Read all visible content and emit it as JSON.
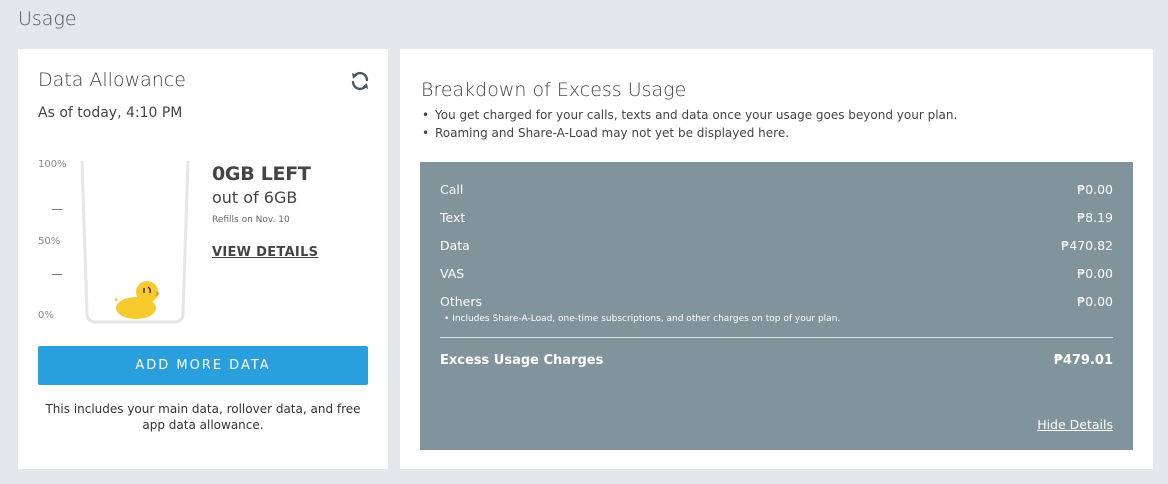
{
  "page": {
    "title": "Usage"
  },
  "data_allowance": {
    "title": "Data Allowance",
    "as_of": "As of today, 4:10 PM",
    "gauge": {
      "labels": [
        "100%",
        "50%",
        "0%"
      ],
      "level_percent": 0
    },
    "left_amount": "0GB LEFT",
    "out_of": "out of 6GB",
    "refills": "Refills on Nov. 10",
    "view_details": "VIEW DETAILS",
    "add_button": "ADD MORE DATA",
    "note": "This includes your main data, rollover data, and free app data allowance.",
    "icon": "refresh-icon"
  },
  "breakdown": {
    "title": "Breakdown of Excess Usage",
    "bullets": [
      "You get charged for your calls, texts and data once your usage goes beyond your plan.",
      "Roaming and Share-A-Load may not yet be displayed here."
    ],
    "rows": [
      {
        "label": "Call",
        "value": "₱0.00"
      },
      {
        "label": "Text",
        "value": "₱8.19"
      },
      {
        "label": "Data",
        "value": "₱470.82"
      },
      {
        "label": "VAS",
        "value": "₱0.00"
      },
      {
        "label": "Others",
        "value": "₱0.00"
      }
    ],
    "others_note": "• Includes Share-A-Load, one-time subscriptions, and other charges on top of your plan.",
    "total_label": "Excess Usage Charges",
    "total_value": "₱479.01",
    "hide_details": "Hide Details",
    "panel_color": "#81949b"
  },
  "colors": {
    "accent": "#2a9fdd",
    "background": "#e4e8ea"
  }
}
